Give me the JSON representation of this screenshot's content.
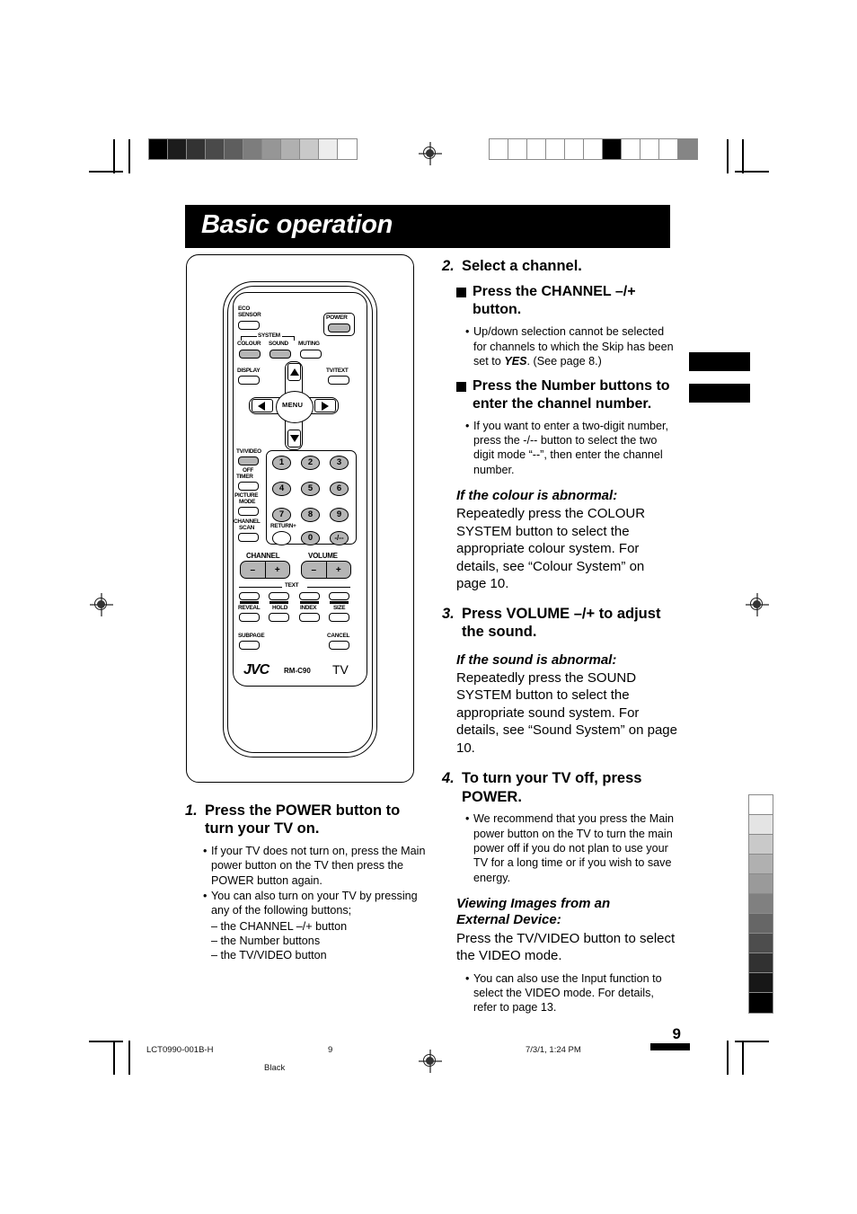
{
  "page": {
    "title": "Basic operation",
    "page_number": "9"
  },
  "footer": {
    "doc_code": "LCT0990-001B-H",
    "page": "9",
    "plate": "Black",
    "timestamp": "7/3/1, 1:24 PM"
  },
  "remote": {
    "brand": "JVC",
    "model": "RM-C90",
    "device": "TV",
    "buttons": {
      "eco_sensor": "ECO\nSENSOR",
      "eco_sensor_l1": "ECO",
      "eco_sensor_l2": "SENSOR",
      "power": "POWER",
      "system": "SYSTEM",
      "colour": "COLOUR",
      "sound": "SOUND",
      "muting": "MUTING",
      "display": "DISPLAY",
      "tvtext": "TV/TEXT",
      "menu": "MENU",
      "tvvideo": "TV/VIDEO",
      "off_timer_l1": "OFF",
      "off_timer_l2": "TIMER",
      "picture_mode_l1": "PICTURE",
      "picture_mode_l2": "MODE",
      "channel_scan_l1": "CHANNEL",
      "channel_scan_l2": "SCAN",
      "return": "RETURN+",
      "channel": "CHANNEL",
      "volume": "VOLUME",
      "minus": "–",
      "plus": "+",
      "text": "TEXT",
      "reveal": "REVEAL",
      "hold": "HOLD",
      "index": "INDEX",
      "size": "SIZE",
      "subpage": "SUBPAGE",
      "cancel": "CANCEL",
      "dash_dash": "-/--"
    },
    "numbers": [
      "1",
      "2",
      "3",
      "4",
      "5",
      "6",
      "7",
      "8",
      "9",
      "0"
    ]
  },
  "steps": {
    "step1": {
      "num": "1.",
      "head": "Press the POWER button to turn your TV on.",
      "bullets": [
        "If your TV does not turn on, press the Main power button on the TV then press the POWER button again.",
        "You can also turn on your TV by pressing any of the following buttons;"
      ],
      "sub_items": [
        "– the CHANNEL –/+ button",
        "– the Number buttons",
        "– the TV/VIDEO button"
      ]
    },
    "step2": {
      "num": "2.",
      "head": "Select a channel.",
      "sub1_head": "Press the CHANNEL –/+ button.",
      "sub1_bullet": "Up/down selection cannot be selected for channels to which the Skip has been set to ",
      "sub1_bullet_em": "YES",
      "sub1_bullet_tail": ". (See page 8.)",
      "sub2_head": "Press the Number buttons to enter the channel number.",
      "sub2_bullet": "If you want to enter a two-digit number, press the -/-- button to select the two digit mode “--”, then enter the channel number."
    },
    "colour_note": {
      "head": "If the colour is abnormal:",
      "body": "Repeatedly press the COLOUR SYSTEM button to select the appropriate colour system. For details, see “Colour System” on page 10."
    },
    "step3": {
      "num": "3.",
      "head": "Press VOLUME –/+ to adjust the sound."
    },
    "sound_note": {
      "head": "If the sound is abnormal:",
      "body": "Repeatedly press the SOUND SYSTEM button to select the appropriate sound system. For details, see “Sound System” on page 10."
    },
    "step4": {
      "num": "4.",
      "head": "To turn your TV off, press POWER.",
      "bullet": "We recommend that you press the Main power button on the TV to turn the main power off if you do not plan to use your TV for a long time or if you wish to save energy."
    },
    "external_note": {
      "head_l1": "Viewing Images from an",
      "head_l2": "External Device:",
      "body": "Press the TV/VIDEO button to select the VIDEO mode.",
      "bullet": "You can also use the Input function to select the VIDEO mode. For details, refer to page 13."
    }
  },
  "calibration": {
    "top_left_strip": [
      "#000000",
      "#1c1c1c",
      "#333333",
      "#4a4a4a",
      "#5e5e5e",
      "#7d7d7d",
      "#969696",
      "#b0b0b0",
      "#c9c9c9",
      "#ededed",
      "#ffffff"
    ],
    "top_right_strip": [
      "#ffffff",
      "#ffffff",
      "#ffffff",
      "#ffffff",
      "#ffffff",
      "#ffffff",
      "#000000",
      "#ffffff",
      "#ffffff",
      "#ffffff",
      "#858585"
    ],
    "right_vertical_strip": [
      "#ffffff",
      "#e4e4e4",
      "#c9c9c9",
      "#b0b0b0",
      "#9a9a9a",
      "#808080",
      "#666666",
      "#4d4d4d",
      "#313131",
      "#171717",
      "#000000"
    ]
  }
}
